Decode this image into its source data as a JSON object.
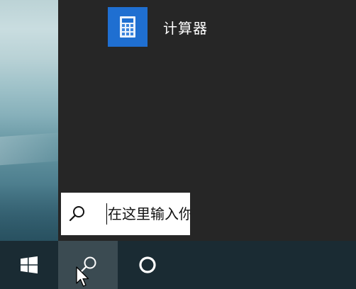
{
  "search_results": {
    "best_match": {
      "label": "计算器",
      "icon": "calculator-icon",
      "tile_color": "#1f6fd1"
    }
  },
  "search_box": {
    "placeholder": "在这里输入你要搜索的内容",
    "value": "",
    "icon": "search-icon"
  },
  "taskbar": {
    "start_icon": "windows-logo-icon",
    "search_icon": "search-icon",
    "cortana_icon": "cortana-circle-icon",
    "background": "#1a2b33",
    "active_button_background": "#3b4b52"
  }
}
